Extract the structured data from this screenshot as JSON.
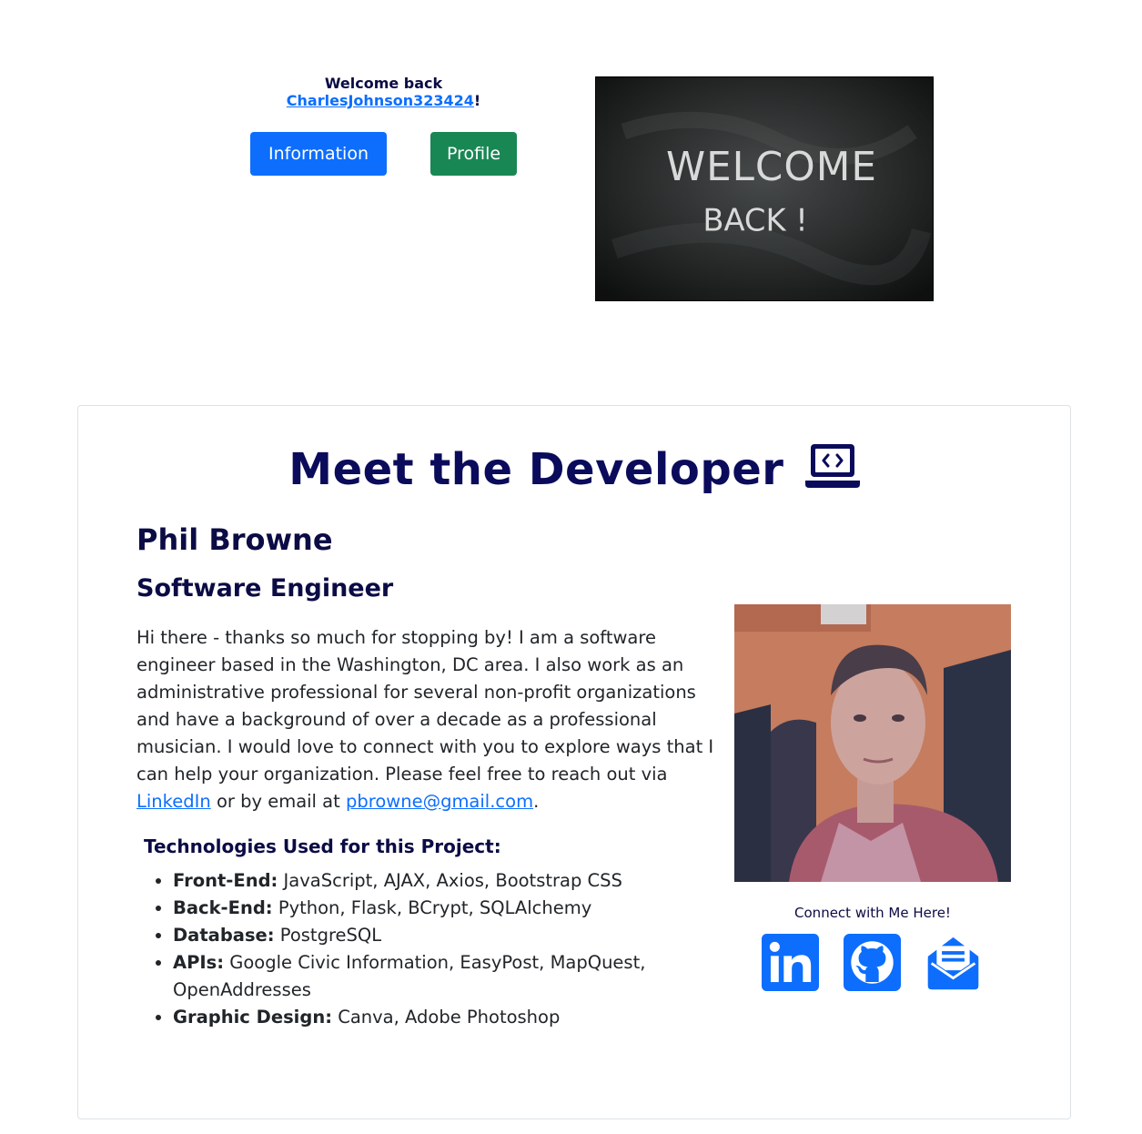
{
  "welcome": {
    "prefix": "Welcome back",
    "username": "CharlesJohnson323424",
    "suffix": "!"
  },
  "buttons": {
    "information": "Information",
    "profile": "Profile"
  },
  "banner_image": {
    "line1": "WELCOME",
    "line2": "BACK !"
  },
  "developer": {
    "title": "Meet the Developer",
    "title_icon": "laptop-code-icon",
    "name": "Phil Browne",
    "role": "Software Engineer",
    "bio_main": "Hi there - thanks so much for stopping by! I am a software engineer based in the Washington, DC area. I also work as an administrative professional for several non-profit organizations and have a background of over a decade as a professional musician. I would love to connect with you to explore ways that I can help your organization. Please feel free to reach out via",
    "bio_link_linkedin": "LinkedIn",
    "bio_mid": "or by email at",
    "bio_link_email": "pbrowne@gmail.com",
    "bio_end": ".",
    "tech_heading": "Technologies Used for this Project:",
    "tech": [
      {
        "label": "Front-End:",
        "value": "JavaScript, AJAX, Axios, Bootstrap CSS"
      },
      {
        "label": "Back-End:",
        "value": "Python, Flask, BCrypt, SQLAlchemy"
      },
      {
        "label": "Database:",
        "value": "PostgreSQL"
      },
      {
        "label": "APIs:",
        "value": "Google Civic Information, EasyPost, MapQuest, OpenAddresses"
      },
      {
        "label": "Graphic Design:",
        "value": "Canva, Adobe Photoshop"
      }
    ],
    "connect_label": "Connect with Me Here!",
    "social_icons": [
      "linkedin-icon",
      "github-icon",
      "email-icon"
    ]
  },
  "colors": {
    "primary": "#0d6efd",
    "success": "#198754",
    "navy": "#0b0b45",
    "border": "#dee2e6"
  }
}
